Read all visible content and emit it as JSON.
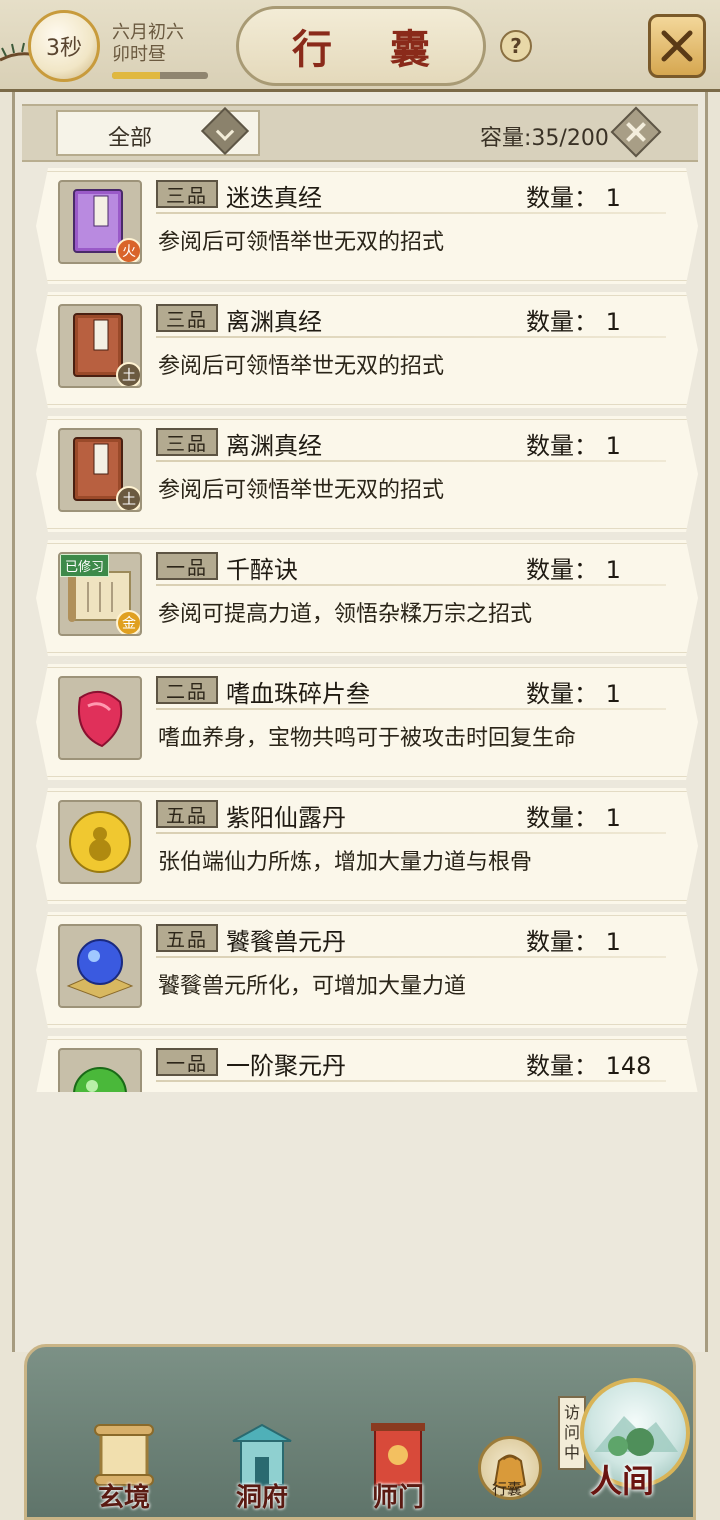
{
  "header": {
    "timer": "3秒",
    "date_line1": "六月初六",
    "date_line2": "卯时昼",
    "time_progress": 0.5,
    "title": "行 囊",
    "help_label": "?"
  },
  "filter": {
    "selected": "全部",
    "capacity": "容量:35/200"
  },
  "items": [
    {
      "grade": "三品",
      "name": "迷迭真经",
      "qty_label": "数量：",
      "qty": "1",
      "desc": "参阅后可领悟举世无双的招式",
      "icon": "purple-scripture-book-icon",
      "element": "火",
      "element_color": "#d9642a"
    },
    {
      "grade": "三品",
      "name": "离渊真经",
      "qty_label": "数量：",
      "qty": "1",
      "desc": "参阅后可领悟举世无双的招式",
      "icon": "brown-scripture-book-icon",
      "element": "土",
      "element_color": "#6b5a40"
    },
    {
      "grade": "三品",
      "name": "离渊真经",
      "qty_label": "数量：",
      "qty": "1",
      "desc": "参阅后可领悟举世无双的招式",
      "icon": "brown-scripture-book-icon",
      "element": "土",
      "element_color": "#6b5a40"
    },
    {
      "grade": "一品",
      "name": "千醉诀",
      "qty_label": "数量：",
      "qty": "1",
      "desc": "参阅可提高力道，领悟杂糅万宗之招式",
      "icon": "scroll-icon",
      "element": "金",
      "element_color": "#e0a020",
      "learned": "已修习"
    },
    {
      "grade": "二品",
      "name": "嗜血珠碎片叁",
      "qty_label": "数量：",
      "qty": "1",
      "desc": "嗜血养身，宝物共鸣可于被攻击时回复生命",
      "icon": "blood-pearl-shard-icon"
    },
    {
      "grade": "五品",
      "name": "紫阳仙露丹",
      "qty_label": "数量：",
      "qty": "1",
      "desc": "张伯端仙力所炼，增加大量力道与根骨",
      "icon": "golden-gourd-pill-icon"
    },
    {
      "grade": "五品",
      "name": "饕餮兽元丹",
      "qty_label": "数量：",
      "qty": "1",
      "desc": "饕餮兽元所化，可增加大量力道",
      "icon": "blue-orb-pill-icon"
    },
    {
      "grade": "一品",
      "name": "一阶聚元丹",
      "qty_label": "数量：",
      "qty": "148",
      "desc": "",
      "icon": "green-pill-icon"
    }
  ],
  "nav": {
    "xuanjing": "玄境",
    "dongfu": "洞府",
    "shimen": "师门",
    "bag": "行囊",
    "visit": "访问中",
    "world": "人间"
  },
  "colors": {
    "title_red": "#8a2a1a",
    "nav_green": "#6f857a",
    "accent_gold": "#c89b3c"
  }
}
